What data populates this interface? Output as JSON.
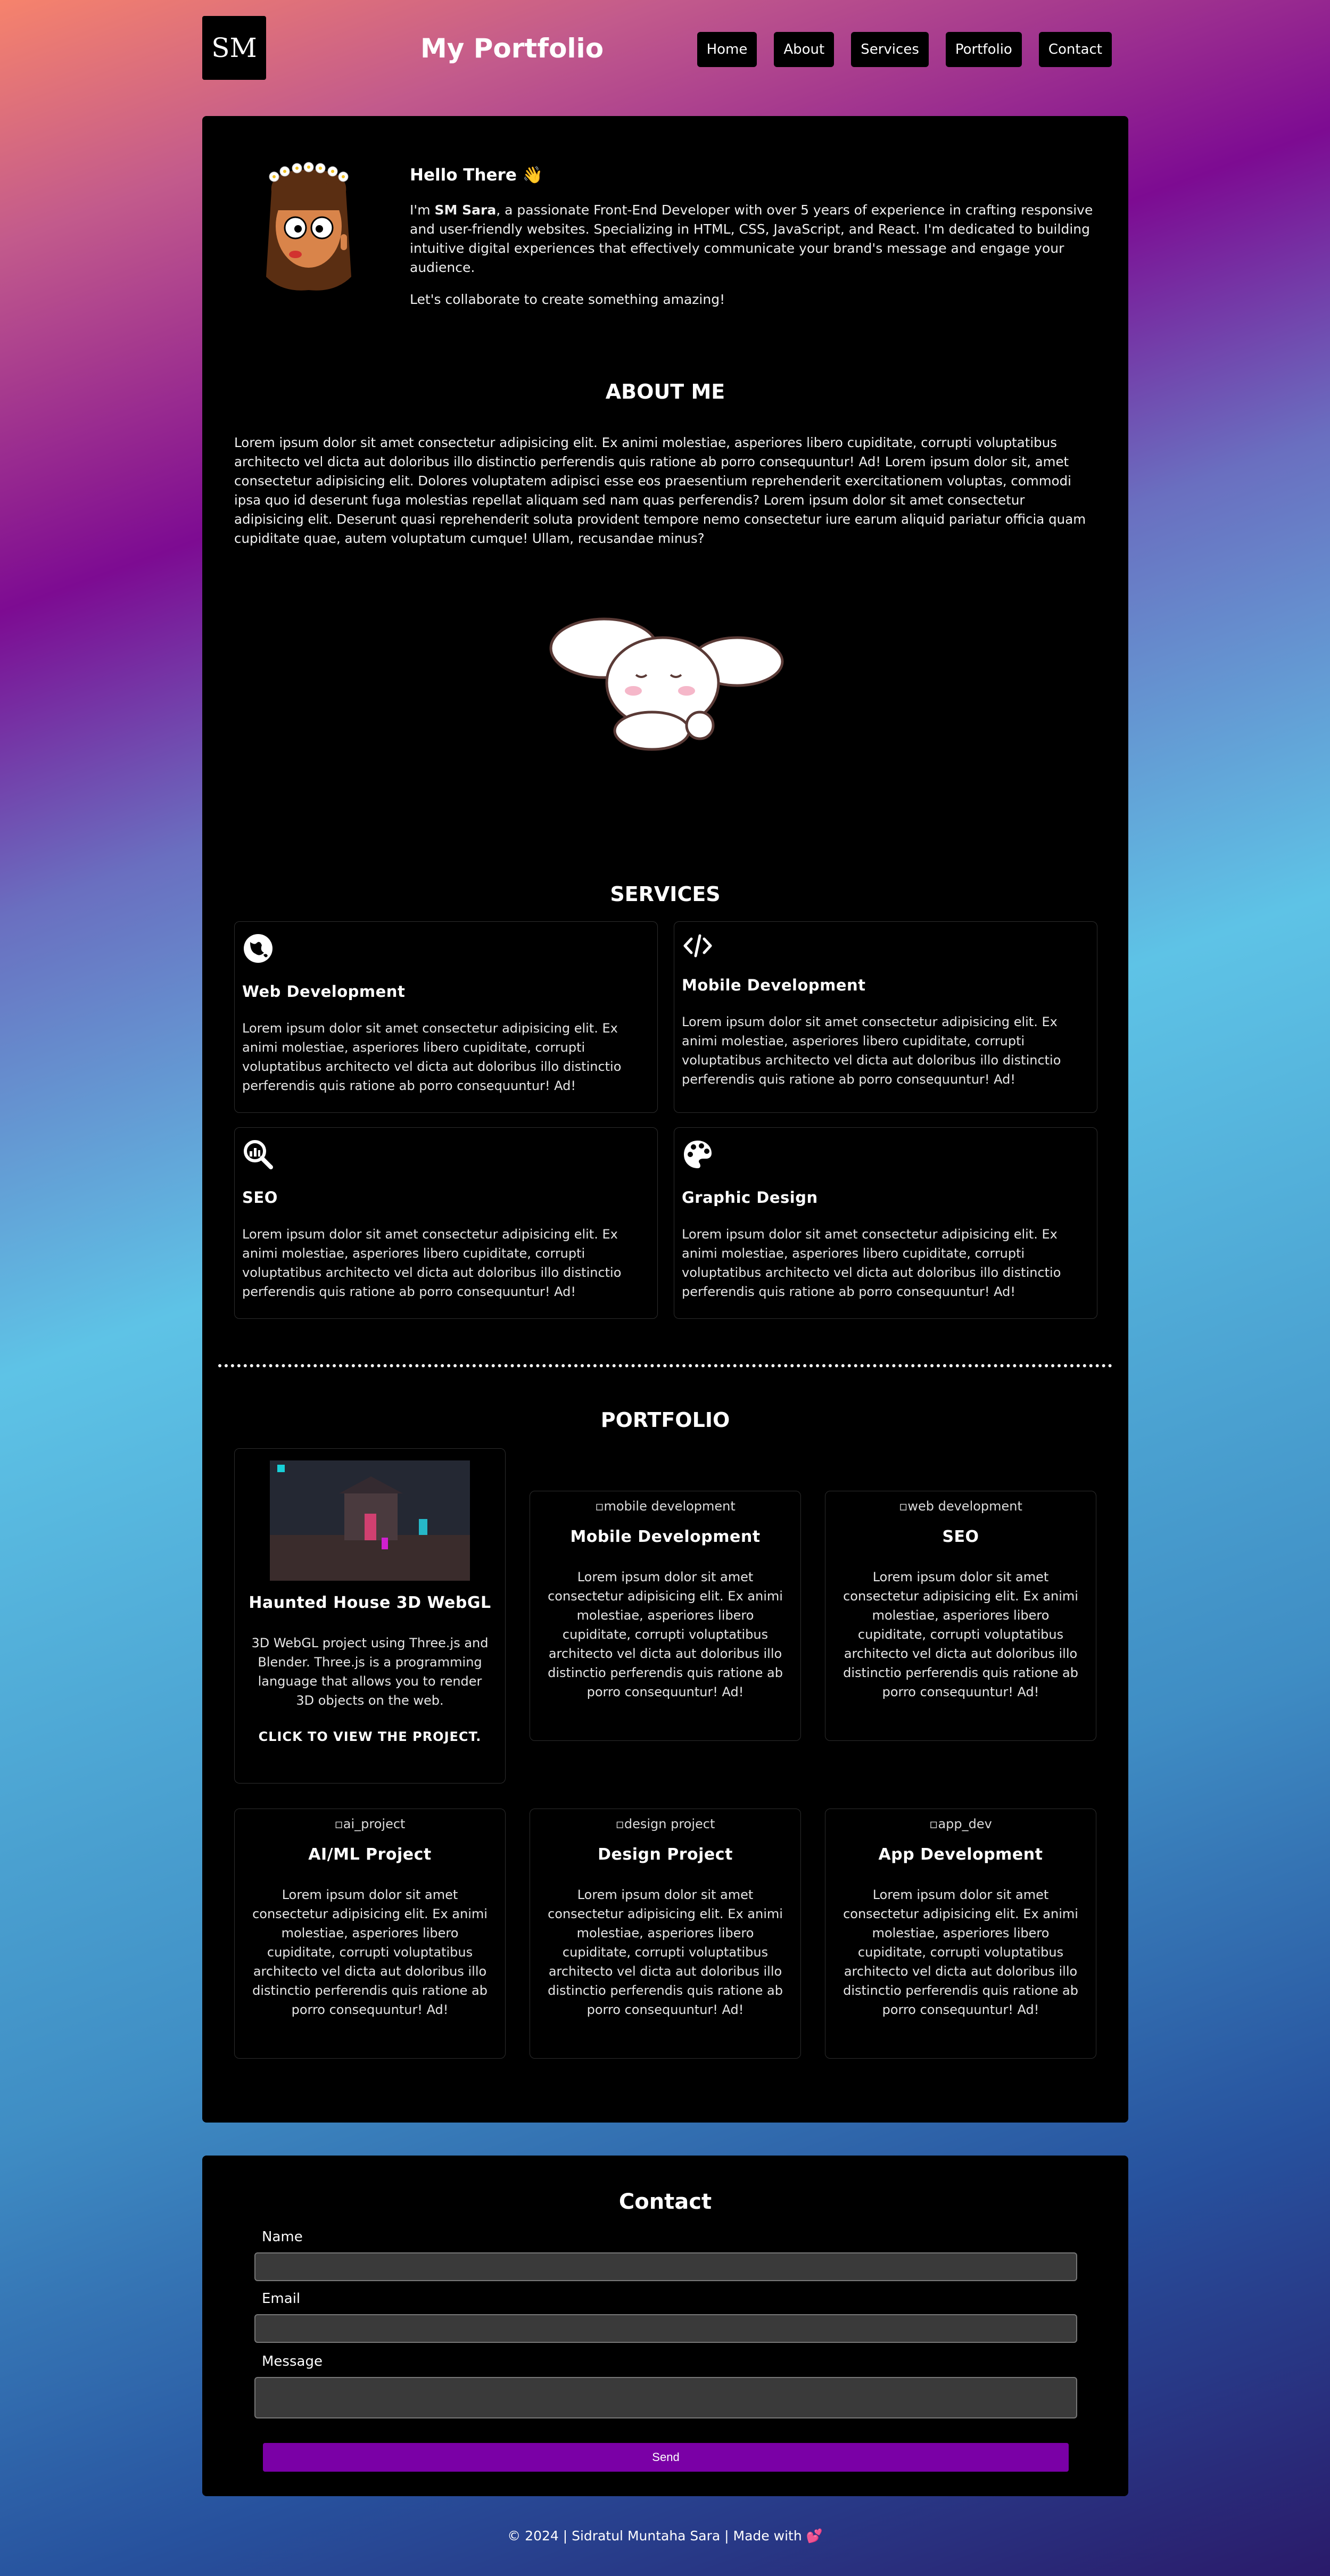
{
  "header": {
    "logo": "SM",
    "title": "My Portfolio",
    "nav": [
      "Home",
      "About",
      "Services",
      "Portfolio",
      "Contact"
    ]
  },
  "intro": {
    "greeting": "Hello There 👋",
    "p1_prefix": "I'm ",
    "p1_name": "SM Sara",
    "p1_rest": ", a passionate Front-End Developer with over 5 years of experience in crafting responsive and user-friendly websites. Specializing in HTML, CSS, JavaScript, and React. I'm dedicated to building intuitive digital experiences that effectively communicate your brand's message and engage your audience.",
    "p2": "Let's collaborate to create something amazing!"
  },
  "about": {
    "title": "ABOUT ME",
    "text": "Lorem ipsum dolor sit amet consectetur adipisicing elit. Ex animi molestiae, asperiores libero cupiditate, corrupti voluptatibus architecto vel dicta aut doloribus illo distinctio perferendis quis ratione ab porro consequuntur! Ad! Lorem ipsum dolor sit, amet consectetur adipisicing elit. Dolores voluptatem adipisci esse eos praesentium reprehenderit exercitationem voluptas, commodi ipsa quo id deserunt fuga molestias repellat aliquam sed nam quas perferendis? Lorem ipsum dolor sit amet consectetur adipisicing elit. Deserunt quasi reprehenderit soluta provident tempore nemo consectetur iure earum aliquid pariatur officia quam cupiditate quae, autem voluptatum cumque! Ullam, recusandae minus?"
  },
  "services": {
    "title": "SERVICES",
    "items": [
      {
        "icon": "globe-icon",
        "title": "Web Development",
        "text": "Lorem ipsum dolor sit amet consectetur adipisicing elit. Ex animi molestiae, asperiores libero cupiditate, corrupti voluptatibus architecto vel dicta aut doloribus illo distinctio perferendis quis ratione ab porro consequuntur! Ad!"
      },
      {
        "icon": "code-icon",
        "title": "Mobile Development",
        "text": "Lorem ipsum dolor sit amet consectetur adipisicing elit. Ex animi molestiae, asperiores libero cupiditate, corrupti voluptatibus architecto vel dicta aut doloribus illo distinctio perferendis quis ratione ab porro consequuntur! Ad!"
      },
      {
        "icon": "search-chart-icon",
        "title": "SEO",
        "text": "Lorem ipsum dolor sit amet consectetur adipisicing elit. Ex animi molestiae, asperiores libero cupiditate, corrupti voluptatibus architecto vel dicta aut doloribus illo distinctio perferendis quis ratione ab porro consequuntur! Ad!"
      },
      {
        "icon": "palette-icon",
        "title": "Graphic Design",
        "text": "Lorem ipsum dolor sit amet consectetur adipisicing elit. Ex animi molestiae, asperiores libero cupiditate, corrupti voluptatibus architecto vel dicta aut doloribus illo distinctio perferendis quis ratione ab porro consequuntur! Ad!"
      }
    ]
  },
  "portfolio": {
    "title": "PORTFOLIO",
    "items": [
      {
        "alt": "",
        "title": "Haunted House 3D WebGL",
        "text": "3D WebGL project using Three.js and Blender. Three.js is a programming language that allows you to render 3D objects on the web.",
        "cta": "CLICK TO VIEW THE PROJECT."
      },
      {
        "alt": "mobile development",
        "title": "Mobile Development",
        "text": "Lorem ipsum dolor sit amet consectetur adipisicing elit. Ex animi molestiae, asperiores libero cupiditate, corrupti voluptatibus architecto vel dicta aut doloribus illo distinctio perferendis quis ratione ab porro consequuntur! Ad!"
      },
      {
        "alt": "web development",
        "title": "SEO",
        "text": "Lorem ipsum dolor sit amet consectetur adipisicing elit. Ex animi molestiae, asperiores libero cupiditate, corrupti voluptatibus architecto vel dicta aut doloribus illo distinctio perferendis quis ratione ab porro consequuntur! Ad!"
      },
      {
        "alt": "ai_project",
        "title": "AI/ML Project",
        "text": "Lorem ipsum dolor sit amet consectetur adipisicing elit. Ex animi molestiae, asperiores libero cupiditate, corrupti voluptatibus architecto vel dicta aut doloribus illo distinctio perferendis quis ratione ab porro consequuntur! Ad!"
      },
      {
        "alt": "design project",
        "title": "Design Project",
        "text": "Lorem ipsum dolor sit amet consectetur adipisicing elit. Ex animi molestiae, asperiores libero cupiditate, corrupti voluptatibus architecto vel dicta aut doloribus illo distinctio perferendis quis ratione ab porro consequuntur! Ad!"
      },
      {
        "alt": "app_dev",
        "title": "App Development",
        "text": "Lorem ipsum dolor sit amet consectetur adipisicing elit. Ex animi molestiae, asperiores libero cupiditate, corrupti voluptatibus architecto vel dicta aut doloribus illo distinctio perferendis quis ratione ab porro consequuntur! Ad!"
      }
    ]
  },
  "contact": {
    "title": "Contact",
    "name_label": "Name",
    "email_label": "Email",
    "message_label": "Message",
    "name_value": "",
    "email_value": "",
    "message_value": "",
    "send_label": "Send"
  },
  "footer": {
    "text": "© 2024 | Sidratul Muntaha Sara | Made with",
    "heart": "💕"
  },
  "colors": {
    "panel": "#000000",
    "send_button": "#7a00a6",
    "input_bg": "#3a3a3a"
  }
}
